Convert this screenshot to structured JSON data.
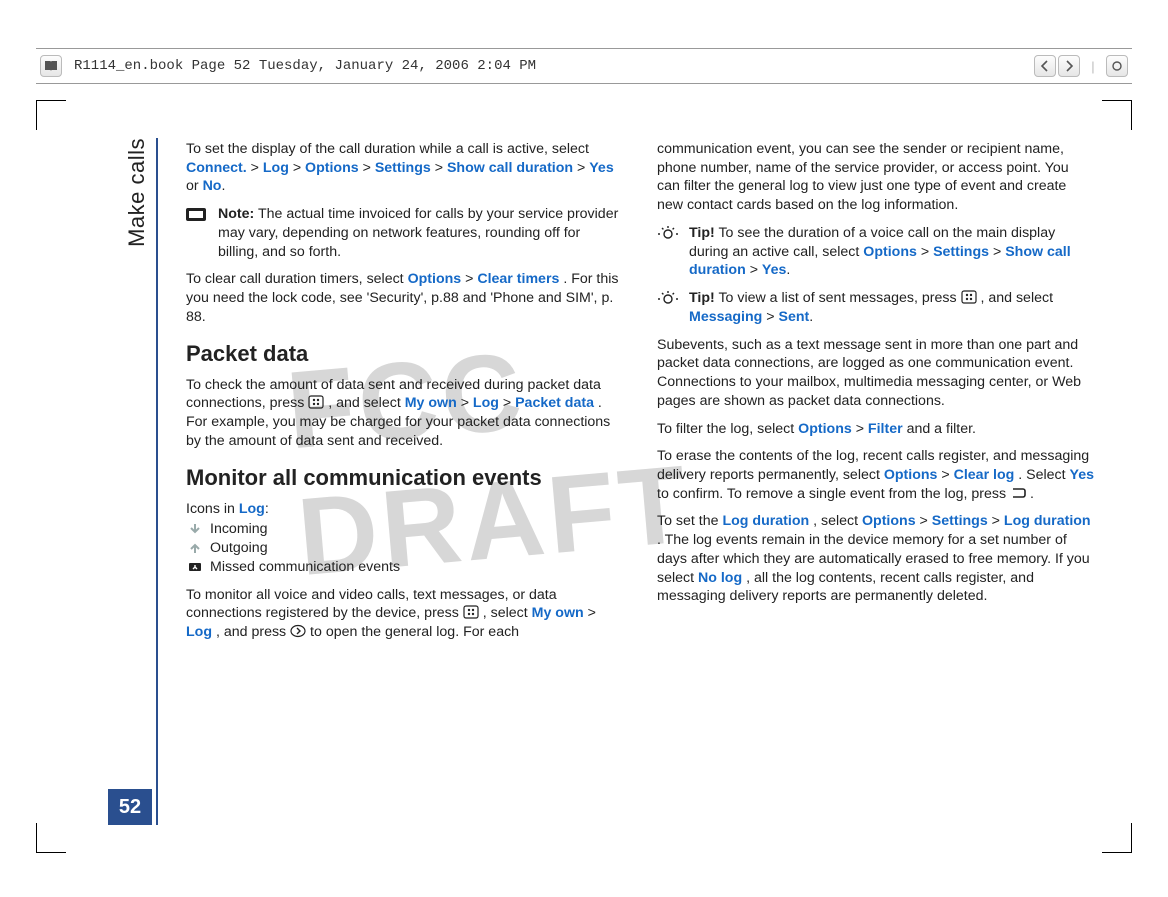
{
  "viewer": {
    "meta": "R1114_en.book  Page 52  Tuesday, January 24, 2006  2:04 PM"
  },
  "watermark": "FCC DRAFT",
  "sidebar": {
    "section": "Make calls",
    "page": "52"
  },
  "body": {
    "p1a": "To set the display of the call duration while a call is active, select ",
    "p1_links": [
      "Connect.",
      "Log",
      "Options",
      "Settings",
      "Show call duration",
      "Yes",
      "No"
    ],
    "p1_sep": " > ",
    "p1_or": " or ",
    "note_label": "Note:",
    "note_text": " The actual time invoiced for calls by your service provider may vary, depending on network features, rounding off for billing, and so forth.",
    "p2a": "To clear call duration timers, select ",
    "p2_links": [
      "Options",
      "Clear timers"
    ],
    "p2b": ". For this you need the lock code, see 'Security', p.88 and 'Phone and SIM', p. 88.",
    "h_packet": "Packet data",
    "p3a": "To check the amount of data sent and received during packet data connections, press ",
    "p3b": ", and select ",
    "p3_links": [
      "My own",
      "Log",
      "Packet data"
    ],
    "p3c": ". For example, you may be charged for your packet data connections by the amount of data sent and received.",
    "h_monitor": "Monitor all communication events",
    "icons_intro_a": "Icons in ",
    "icons_intro_link": "Log",
    "icons_intro_b": ":",
    "icon_rows": [
      "Incoming",
      "Outgoing",
      "Missed communication events"
    ],
    "p4a": "To monitor all voice and video calls, text messages, or data connections registered by the device, press ",
    "p4b": ", select ",
    "p4_links": [
      "My own",
      "Log"
    ],
    "p4c": ", and press ",
    "p4d": " to open the general log. For each ",
    "p5": "communication event, you can see the sender or recipient name, phone number, name of the service provider, or access point. You can filter the general log to view just one type of event and create new contact cards based on the log information.",
    "tip_label": "Tip!",
    "tip1a": " To see the duration of a voice call on the main display during an active call, select ",
    "tip1_links": [
      "Options",
      "Settings",
      "Show call duration",
      "Yes"
    ],
    "tip2a": " To view a list of sent messages, press ",
    "tip2b": ", and select ",
    "tip2_links": [
      "Messaging",
      "Sent"
    ],
    "p6": "Subevents, such as a text message sent in more than one part and packet data connections, are logged as one communication event. Connections to your mailbox, multimedia messaging center, or Web pages are shown as packet data connections.",
    "p7a": "To filter the log, select ",
    "p7_links": [
      "Options",
      "Filter"
    ],
    "p7b": " and a filter.",
    "p8a": "To erase the contents of the log, recent calls register, and messaging delivery reports permanently, select ",
    "p8_links": [
      "Options",
      "Clear log"
    ],
    "p8b": ". Select ",
    "p8_link_yes": "Yes",
    "p8c": " to confirm. To remove a single event from the log, press ",
    "p8d": " .",
    "p9a": "To set the ",
    "p9_link1": "Log duration",
    "p9b": ", select ",
    "p9_links": [
      "Options",
      "Settings",
      "Log duration"
    ],
    "p9c": ". The log events remain in the device memory for a set number of days after which they are automatically erased to free memory. If you select ",
    "p9_link_nolog": "No log",
    "p9d": ", all the log contents, recent calls register, and messaging delivery reports are permanently deleted."
  }
}
